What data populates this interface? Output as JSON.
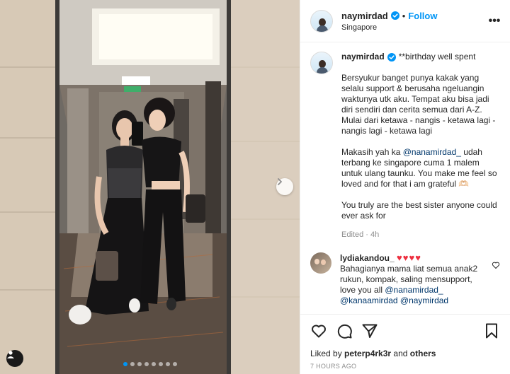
{
  "post": {
    "username": "naymirdad",
    "follow_label": "Follow",
    "separator": "•",
    "location": "Singapore",
    "more_label": "•••"
  },
  "caption": {
    "username": "naymirdad",
    "first_line": "**birthday well spent",
    "para1": "Bersyukur banget punya kakak yang selalu support & berusaha ngeluangin waktunya utk aku. Tempat aku bisa jadi diri sendiri dan cerita semua dari A-Z. Mulai dari ketawa - nangis - ketawa lagi - nangis lagi - ketawa lagi",
    "para2_prefix": "Makasih yah ka ",
    "para2_mention": "@nanamirdad_",
    "para2_suffix": " udah terbang ke singapore cuma 1 malem untuk ulang taunku. You make me feel so loved and for that i am grateful 🫶🏻",
    "para3": "You truly are the best sister anyone could ever ask for",
    "edited": "Edited · 4h"
  },
  "comment": {
    "username": "lydiakandou_",
    "hearts": "♥♥♥♥",
    "text_prefix": "Bahagianya mama liat semua anak2 rukun, kompak, saling mensupport, love you all ",
    "mention1": "@nanamirdad_",
    "mention2": "@kanaamirdad @naymirdad"
  },
  "likes": {
    "prefix": "Liked by ",
    "user": "peterp4rk3r",
    "middle": " and ",
    "others": "others"
  },
  "timestamp": "7 HOURS AGO",
  "carousel": {
    "count": 8,
    "active_index": 0
  },
  "colors": {
    "accent": "#0095f6",
    "heart": "#ed2f3f",
    "mention": "#00376b"
  }
}
